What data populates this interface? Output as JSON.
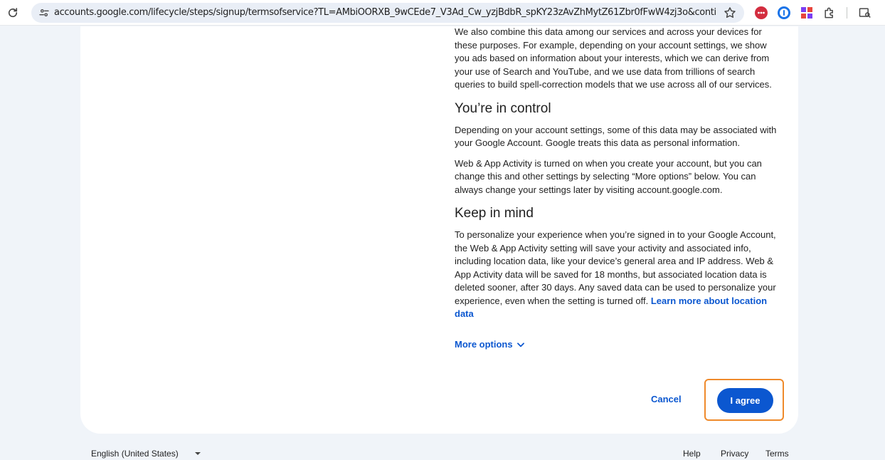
{
  "browser": {
    "url": "accounts.google.com/lifecycle/steps/signup/termsofservice?TL=AMbiOORXB_9wCEde7_V3Ad_Cw_yzjBdbR_spKY23zAvZhMytZ61Zbr0fFwW4zj3o&continue=https%3A...",
    "icons": [
      "reload-icon",
      "tune-icon",
      "star-icon",
      "lastpass-icon",
      "onepassword-icon",
      "extension-grid-icon",
      "puzzle-icon",
      "tab-search-icon"
    ],
    "colors": {
      "lastpass": "#d32d3f",
      "onepassword": "#1a73e8",
      "grid": "#7b3ff2"
    }
  },
  "content": {
    "intro_paragraph": "We also combine this data among our services and across your devices for these purposes. For example, depending on your account settings, we show you ads based on information about your interests, which we can derive from your use of Search and YouTube, and we use data from trillions of search queries to build spell-correction models that we use across all of our services.",
    "section1_title": "You’re in control",
    "section1_para1": "Depending on your account settings, some of this data may be associated with your Google Account. Google treats this data as personal information.",
    "section1_para2": "Web & App Activity is turned on when you create your account, but you can change this and other settings by selecting “More options” below. You can always change your settings later by visiting account.google.com.",
    "section2_title": "Keep in mind",
    "section2_para": "To personalize your experience when you’re signed in to your Google Account, the Web & App Activity setting will save your activity and associated info, including location data, like your device’s general area and IP address. Web & App Activity data will be saved for 18 months, but associated location data is deleted sooner, after 30 days. Any saved data can be used to personalize your experience, even when the setting is turned off.",
    "learn_more_link": "Learn more about location data"
  },
  "actions": {
    "more_options": "More options",
    "cancel": "Cancel",
    "agree": "I agree",
    "highlight_color": "#ef8a2b",
    "primary_color": "#0b57d0"
  },
  "footer": {
    "language": "English (United States)",
    "help": "Help",
    "privacy": "Privacy",
    "terms": "Terms"
  }
}
